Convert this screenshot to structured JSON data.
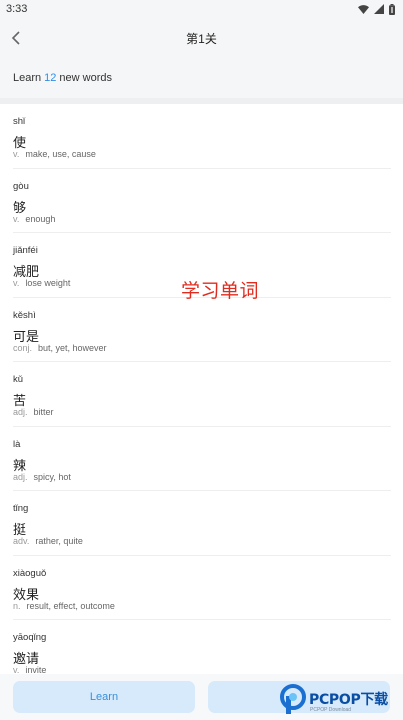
{
  "status_bar": {
    "time": "3:33"
  },
  "header": {
    "title": "第1关"
  },
  "learn_bar": {
    "prefix": "Learn",
    "count": "12",
    "suffix": "new words"
  },
  "words": [
    {
      "pinyin": "shǐ",
      "hanzi": "使",
      "pos": "v.",
      "meaning": "make, use, cause"
    },
    {
      "pinyin": "gòu",
      "hanzi": "够",
      "pos": "v.",
      "meaning": "enough"
    },
    {
      "pinyin": "jiǎnféi",
      "hanzi": "减肥",
      "pos": "v.",
      "meaning": "lose weight"
    },
    {
      "pinyin": "kěshì",
      "hanzi": "可是",
      "pos": "conj.",
      "meaning": "but, yet, however"
    },
    {
      "pinyin": "kǔ",
      "hanzi": "苦",
      "pos": "adj.",
      "meaning": "bitter"
    },
    {
      "pinyin": "là",
      "hanzi": "辣",
      "pos": "adj.",
      "meaning": "spicy, hot"
    },
    {
      "pinyin": "tǐng",
      "hanzi": "挺",
      "pos": "adv.",
      "meaning": "rather, quite"
    },
    {
      "pinyin": "xiàoguǒ",
      "hanzi": "效果",
      "pos": "n.",
      "meaning": "result, effect, outcome"
    },
    {
      "pinyin": "yāoqǐng",
      "hanzi": "邀请",
      "pos": "v.",
      "meaning": "invite"
    }
  ],
  "watermark": "学习单词",
  "bottom": {
    "learn_label": "Learn"
  },
  "logo": {
    "text": "PCPOP下载",
    "sub": "PCPOP Download"
  },
  "colors": {
    "accent": "#2f8ee6",
    "button_bg": "#d6eafc",
    "watermark": "#e02c1e"
  }
}
